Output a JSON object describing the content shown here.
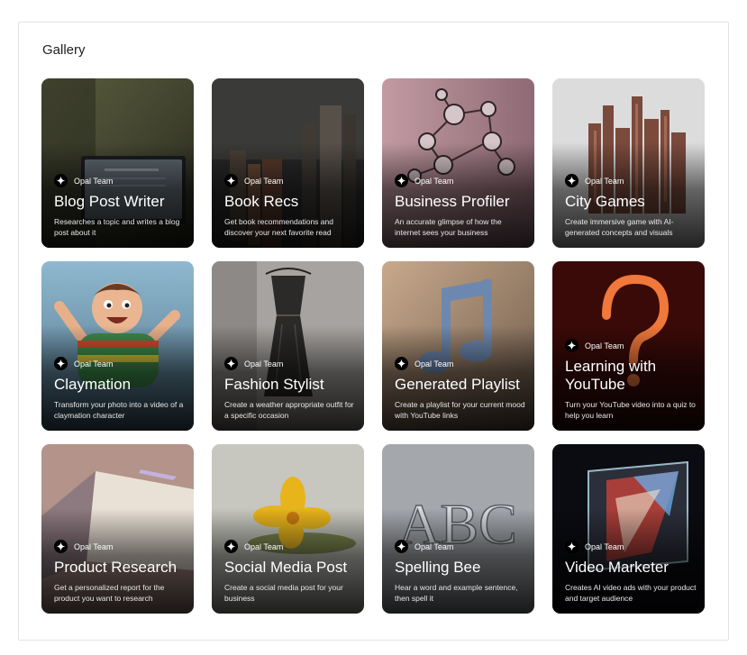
{
  "gallery": {
    "title": "Gallery",
    "team_label": "Opal Team",
    "cards": [
      {
        "name": "Blog Post Writer",
        "desc": "Researches a topic and writes a blog post about it",
        "art": "blog"
      },
      {
        "name": "Book Recs",
        "desc": "Get book recommendations and discover your next favorite read",
        "art": "books"
      },
      {
        "name": "Business Profiler",
        "desc": "An accurate glimpse of how the internet sees your business",
        "art": "network"
      },
      {
        "name": "City Games",
        "desc": "Create immersive game with AI-generated concepts and visuals",
        "art": "city"
      },
      {
        "name": "Claymation",
        "desc": "Transform your photo into a video of a claymation character",
        "art": "clay"
      },
      {
        "name": "Fashion Stylist",
        "desc": "Create a weather appropriate outfit for a specific occasion",
        "art": "dress"
      },
      {
        "name": "Generated Playlist",
        "desc": "Create a playlist for your current mood with YouTube links",
        "art": "music"
      },
      {
        "name": "Learning with YouTube",
        "desc": "Turn your YouTube video into a quiz to help you learn",
        "art": "question"
      },
      {
        "name": "Product Research",
        "desc": "Get a personalized report for the product you want to research",
        "art": "product"
      },
      {
        "name": "Social Media Post",
        "desc": "Create a social media post for your business",
        "art": "flower"
      },
      {
        "name": "Spelling Bee",
        "desc": "Hear a word and example sentence, then spell it",
        "art": "abc",
        "art_text": "ABC"
      },
      {
        "name": "Video Marketer",
        "desc": "Creates AI video ads with your product and target audience",
        "art": "video"
      }
    ]
  }
}
